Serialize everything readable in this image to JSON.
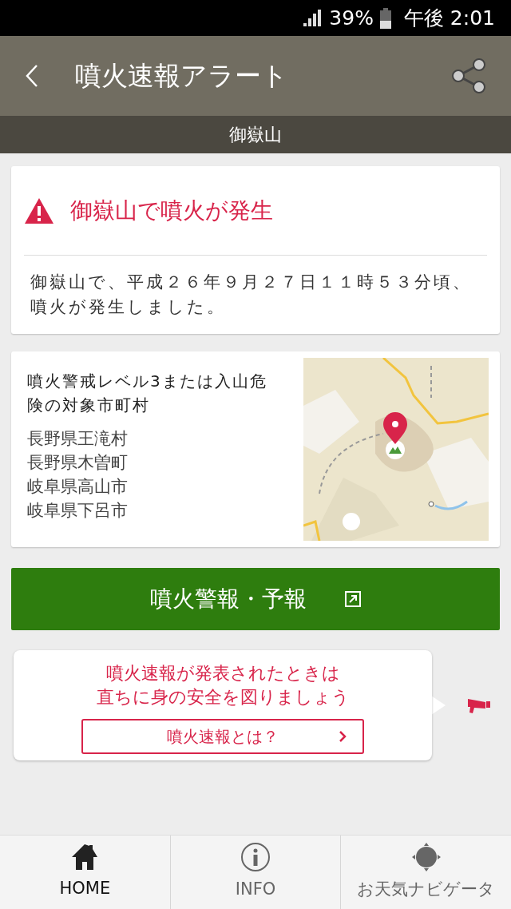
{
  "status_bar": {
    "battery": "39%",
    "time": "午後 2:01"
  },
  "header": {
    "title": "噴火速報アラート",
    "subtitle": "御嶽山"
  },
  "alert": {
    "title": "御嶽山で噴火が発生",
    "body": "御嶽山で、平成２６年９月２７日１１時５３分頃、噴火が発生しました。"
  },
  "areas": {
    "heading": "噴火警戒レベル3または入山危険の対象市町村",
    "items": [
      "長野県王滝村",
      "長野県木曽町",
      "岐阜県高山市",
      "岐阜県下呂市"
    ]
  },
  "warning_button": "噴火警報・予報",
  "notice": {
    "message_lines": [
      "噴火速報が発表されたときは",
      "直ちに身の安全を図りましょう"
    ],
    "link": "噴火速報とは？"
  },
  "bottom_nav": [
    {
      "label": "HOME",
      "kind": "home",
      "selected": true
    },
    {
      "label": "INFO",
      "kind": "info",
      "selected": false
    },
    {
      "label": "お天気ナビゲータ",
      "kind": "navi",
      "selected": false
    }
  ]
}
